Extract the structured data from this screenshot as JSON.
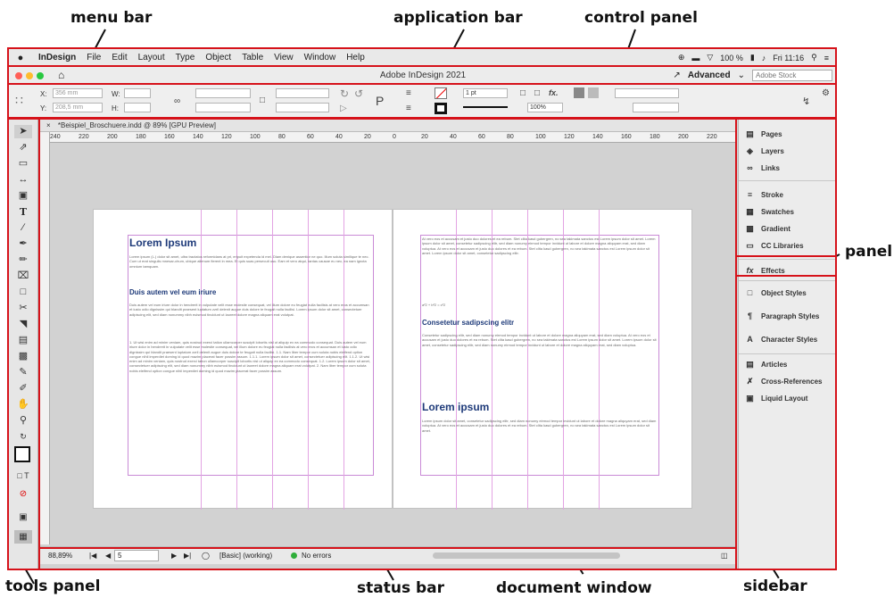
{
  "callouts": {
    "menu_bar": "menu bar",
    "application_bar": "application bar",
    "control_panel": "control panel",
    "panel": "panel",
    "tools_panel": "tools panel",
    "status_bar": "status bar",
    "document_window": "document window",
    "sidebar": "sidebar"
  },
  "menubar": {
    "apple": "",
    "items": [
      "InDesign",
      "File",
      "Edit",
      "Layout",
      "Type",
      "Object",
      "Table",
      "View",
      "Window",
      "Help"
    ],
    "battery": "100 %",
    "clock": "Fri 11:16"
  },
  "appbar": {
    "title": "Adobe InDesign 2021",
    "workspace": "Advanced",
    "search_placeholder": "Adobe Stock"
  },
  "control": {
    "x_label": "X:",
    "x_value": "356 mm",
    "y_label": "Y:",
    "y_value": "208,5 mm",
    "w_label": "W:",
    "h_label": "H:",
    "stroke_weight": "1 pt",
    "opacity": "100%",
    "fx": "fx."
  },
  "document": {
    "tab": "*Beispiel_Broschuere.indd @ 89% [GPU Preview]",
    "ruler_ticks": [
      "240",
      "220",
      "200",
      "180",
      "160",
      "140",
      "120",
      "100",
      "80",
      "60",
      "40",
      "20",
      "0",
      "20",
      "40",
      "60",
      "80",
      "100",
      "120",
      "140",
      "160",
      "180",
      "200",
      "220"
    ],
    "left_page": {
      "heading1": "Lorem Ipsum",
      "intro": "Lorem ipsum (L.) dolor sit amet, ultra tractatos reformidans at pri, eripuit expetenda id mei. Diam denique assentior ne quo. Illum soluta similique te nec. Cum ut erat singulis mnesar-chum, ubique alienum fierent in mea. Ei quis suas persecuti usu. Eam et vero atqui, tantas causae eu nec, ea nam ignota omnium tamquam.",
      "heading2": "Duis autem vel eum iriure",
      "para": "Duis autem vel eum iriure dolor in hendrerit in vulputate velit esse molestie consequat, vel illum dolore eu feugiat nulla facilisis at vero eros et accumsan et iusto odio dignissim qui blandit praesent luptatum zzril delenit augue duis dolore te feugait nulla facilisi. Lorem ipsum dolor sit amet, consectetuer adipiscing elit, sed diam nonummy nibh euismod tincidunt ut laoreet dolore magna aliquam erat volutpat.",
      "list": "1. Ut wisi enim ad minim veniam, quis nostrud exerci tation ullamcorper suscipit lobortis nisl ut aliquip ex ea commodo consequat. Duis autem vel eum iriure dolor in hendrerit in vulputate velit esse molestie consequat, vel illum dolore eu feugiat nulla facilisis at vero eros et accumsan et iusto odio dignissim qui blandit praesent luptatum zzril delenit augue duis dolore te feugait nulla facilisi. 1.1. Nam liber tempor cum soluta nobis eleifend option congue nihil imperdiet doming id quod mazim placerat facer possim assum. 1.1.1. Lorem ipsum dolor sit amet, consectetuer adipiscing elit. 1.1.2. Ut wisi enim ad minim veniam, quis nostrud exerci tation ullamcorper suscipit lobortis nisl ut aliquip ex ea commodo consequat. 1.2. Lorem ipsum dolor sit amet, consectetuer adipiscing elit, sed diam nonummy nibh euismod tincidunt ut laoreet dolore magna aliquam erat volutpat. 2. Nam liber tempor cum soluta nobis eleifend option congue nihil imperdiet doming id quod mazim placerat facer possim assum."
    },
    "right_page": {
      "para1": "At vero eos et accusam et justo duo dolores et ea rebum. Stet clita kasd gubergren, no sea takimata sanctus est Lorem ipsum dolor sit amet. Lorem ipsum dolor sit amet, consetetur sadipscing elitr, sed diam nonumy eirmod tempor invidunt ut labore et dolore magna aliquyam erat, sed diam voluptua. At vero eos et accusam et justo duo dolores et ea rebum. Stet clita kasd gubergren, no sea takimata sanctus est Lorem ipsum dolor sit amet. Lorem ipsum dolor sit amet, consetetur sadipscing elitr.",
      "formula": "a²2 + b²2 = c²2",
      "heading2": "Consetetur sadipscing elitr",
      "para2": "Consetetur sadipscing elitr, sed diam nonumy eirmod tempor invidunt ut labore et dolore magna aliquyam erat, sed diam voluptua. At vero eos et accusam et justo duo dolores et ea rebum. Stet clita kasd gubergren, no sea takimata sanctus est Lorem ipsum dolor sit amet. Lorem ipsum dolor sit amet, consetetur sadipscing elitr, sed diam nonumy eirmod tempor invidunt ut labore et dolore magna aliquyam erat, sed diam voluptua.",
      "heading1": "Lorem ipsum",
      "para3": "Lorem ipsum dolor sit amet, consetetur sadipscing elitr, sed diam nonumy eirmod tempor invidunt ut labore et dolore magna aliquyam erat, sed diam voluptua. At vero eos et accusam et justo duo dolores et ea rebum. Stet clita kasd gubergren, no sea takimata sanctus est Lorem ipsum dolor sit amet."
    }
  },
  "statusbar": {
    "zoom": "88,89%",
    "page": "5",
    "preflight_profile": "[Basic] (working)",
    "errors": "No errors"
  },
  "sidebar": {
    "items": [
      "Pages",
      "Layers",
      "Links",
      "Stroke",
      "Swatches",
      "Gradient",
      "CC Libraries",
      "Effects",
      "Object Styles",
      "Paragraph Styles",
      "Character Styles",
      "Articles",
      "Cross-References",
      "Liquid Layout"
    ],
    "icons": [
      "pages-icon",
      "layers-icon",
      "links-icon",
      "stroke-icon",
      "swatches-icon",
      "gradient-icon",
      "cc-libraries-icon",
      "effects-icon",
      "object-styles-icon",
      "paragraph-styles-icon",
      "character-styles-icon",
      "articles-icon",
      "cross-references-icon",
      "liquid-layout-icon"
    ]
  },
  "colors": {
    "highlight_red": "#d6121a",
    "heading_blue": "#1f3b7a",
    "guide_magenta": "#c98ad6"
  }
}
